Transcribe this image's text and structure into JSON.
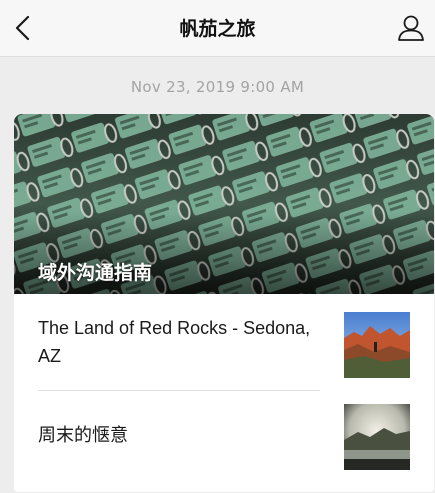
{
  "header": {
    "title": "帆茄之旅",
    "back_icon": "chevron-left-icon",
    "profile_icon": "person-icon"
  },
  "timestamp": "Nov 23, 2019 9:00 AM",
  "card": {
    "cover_title": "域外沟通指南",
    "items": [
      {
        "title": "The Land of Red Rocks - Sedona, AZ"
      },
      {
        "title": "周末的惬意"
      }
    ]
  },
  "colors": {
    "background": "#ededed",
    "nav_background": "#f7f7f7",
    "card": "#ffffff",
    "timestamp_text": "#a3a3a3"
  }
}
